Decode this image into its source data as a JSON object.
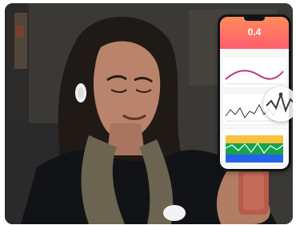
{
  "scene": {
    "alt_subject": "woman-wearing-sensor-looking-at-phone"
  },
  "phone_ui": {
    "headline_value": "0.4",
    "left_metric": "",
    "right_metric": "",
    "chart1_title": "",
    "chart2_title": "",
    "chart3_title": ""
  }
}
